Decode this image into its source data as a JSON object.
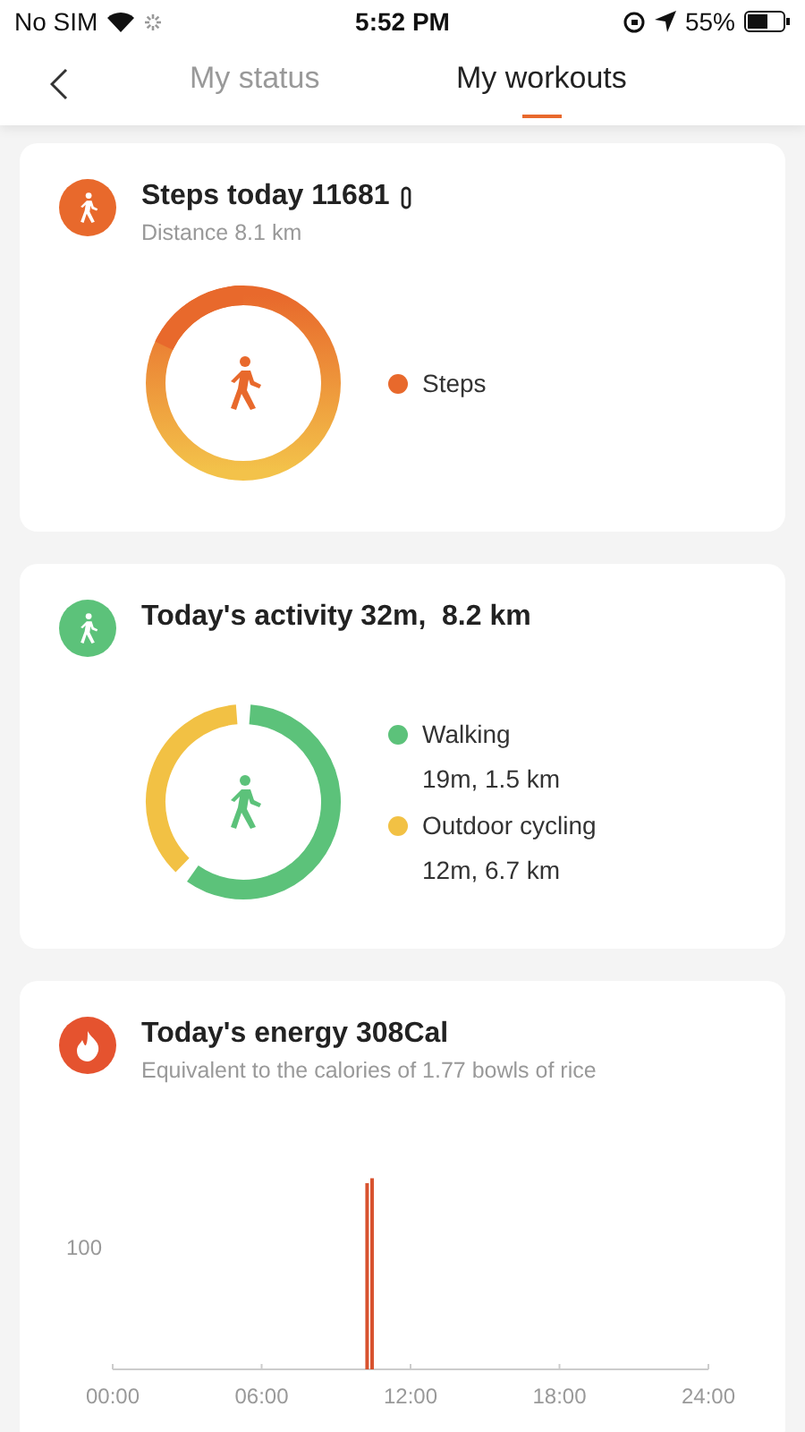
{
  "status_bar": {
    "carrier": "No SIM",
    "time": "5:52 PM",
    "battery": "55%"
  },
  "tabs": [
    {
      "label": "My status",
      "selected": false
    },
    {
      "label": "My workouts",
      "selected": true
    }
  ],
  "cards": [
    {
      "kind": "steps",
      "title": "Steps today 11681",
      "subtitle": "Distance 8.1 km",
      "legend": [
        {
          "label": "Steps",
          "color": "#e8692c"
        }
      ]
    },
    {
      "kind": "activity",
      "title": "Today's activity 32m,  8.2 km",
      "legend": [
        {
          "label": "Walking",
          "detail": "19m,  1.5 km",
          "color": "#5cc27a"
        },
        {
          "label": "Outdoor cycling",
          "detail": "12m,  6.7 km",
          "color": "#f2c144"
        }
      ]
    },
    {
      "kind": "energy",
      "title": "Today's energy 308Cal",
      "subtitle": "Equivalent to the calories of 1.77 bowls of rice",
      "chart": {
        "x_labels": [
          "00:00",
          "06:00",
          "12:00",
          "18:00",
          "24:00"
        ],
        "y_label": "100"
      }
    }
  ]
}
